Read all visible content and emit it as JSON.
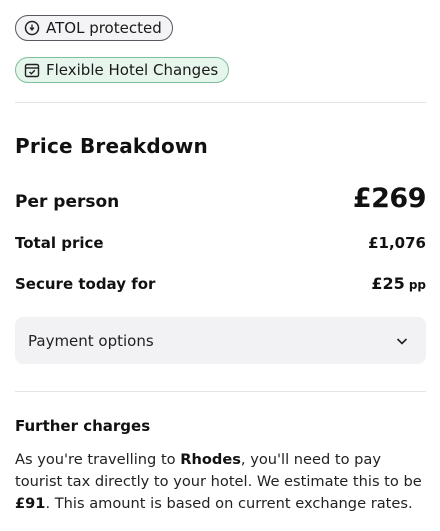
{
  "badges": {
    "atol": {
      "label": "ATOL protected",
      "icon": "atol-shield-icon"
    },
    "flexible": {
      "label": "Flexible Hotel Changes",
      "icon": "calendar-check-icon"
    }
  },
  "price_breakdown": {
    "title": "Price Breakdown",
    "per_person": {
      "label": "Per person",
      "value": "£269"
    },
    "total": {
      "label": "Total price",
      "value": "£1,076"
    },
    "secure": {
      "label": "Secure today for",
      "value": "£25",
      "unit": "pp"
    }
  },
  "payment_options": {
    "label": "Payment options",
    "icon": "chevron-down-icon"
  },
  "further_charges": {
    "title": "Further charges",
    "text_part1": "As you're travelling to ",
    "destination": "Rhodes",
    "text_part2": ", you'll need to pay tourist tax directly to your hotel. We estimate this to be ",
    "amount": "£91",
    "text_part3": ". This amount is based on current exchange rates."
  },
  "colors": {
    "flexible_badge_bg": "#e6f6ec",
    "flexible_badge_border": "#7fbf9a",
    "payment_bg": "#f2f2f5"
  }
}
